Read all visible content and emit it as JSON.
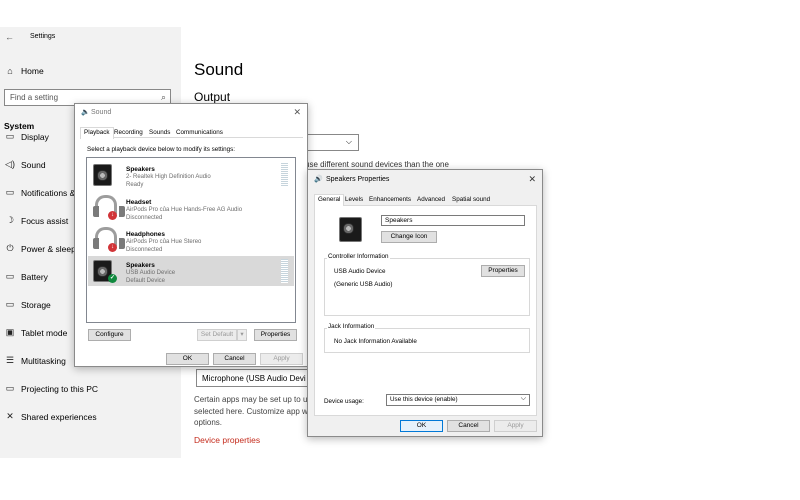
{
  "settings": {
    "title": "Settings",
    "home": "Home",
    "search_placeholder": "Find a setting",
    "section": "System",
    "nav": [
      {
        "label": "Display",
        "icon": "monitor-icon"
      },
      {
        "label": "Sound",
        "icon": "speaker-icon"
      },
      {
        "label": "Notifications &",
        "icon": "notification-icon"
      },
      {
        "label": "Focus assist",
        "icon": "moon-icon"
      },
      {
        "label": "Power & sleep",
        "icon": "power-icon"
      },
      {
        "label": "Battery",
        "icon": "battery-icon"
      },
      {
        "label": "Storage",
        "icon": "storage-icon"
      },
      {
        "label": "Tablet mode",
        "icon": "tablet-icon"
      },
      {
        "label": "Multitasking",
        "icon": "multitasking-icon"
      },
      {
        "label": "Projecting to this PC",
        "icon": "projecting-icon"
      },
      {
        "label": "Shared experiences",
        "icon": "shared-icon"
      }
    ],
    "page_title": "Sound",
    "output_heading": "Output",
    "partial_text": "use different sound devices than the one",
    "input_device": "Microphone (USB Audio Devi",
    "apps_text_1": "Certain apps may be set up to u",
    "apps_text_2": "selected here. Customize app w",
    "apps_text_3": "options.",
    "device_properties_link": "Device properties"
  },
  "sound_dialog": {
    "title": "Sound",
    "tabs": [
      "Playback",
      "Recording",
      "Sounds",
      "Communications"
    ],
    "instruction": "Select a playback device below to modify its settings:",
    "devices": [
      {
        "name": "Speakers",
        "line1": "2- Realtek High Definition Audio",
        "line2": "Ready",
        "icon": "speaker-icon"
      },
      {
        "name": "Headset",
        "line1": "AirPods Pro của Hue Hands-Free AG Audio",
        "line2": "Disconnected",
        "icon": "headset-icon"
      },
      {
        "name": "Headphones",
        "line1": "AirPods Pro của Hue Stereo",
        "line2": "Disconnected",
        "icon": "headphones-icon"
      },
      {
        "name": "Speakers",
        "line1": "USB Audio Device",
        "line2": "Default Device",
        "icon": "speaker-icon"
      }
    ],
    "configure": "Configure",
    "set_default": "Set Default",
    "properties": "Properties",
    "ok": "OK",
    "cancel": "Cancel",
    "apply": "Apply"
  },
  "props_dialog": {
    "title": "Speakers Properties",
    "tabs": [
      "General",
      "Levels",
      "Enhancements",
      "Advanced",
      "Spatial sound"
    ],
    "name_value": "Speakers",
    "change_icon": "Change Icon",
    "controller_heading": "Controller Information",
    "controller_name": "USB Audio Device",
    "controller_sub": "(Generic USB Audio)",
    "controller_properties": "Properties",
    "jack_heading": "Jack Information",
    "jack_text": "No Jack Information Available",
    "usage_label": "Device usage:",
    "usage_value": "Use this device (enable)",
    "ok": "OK",
    "cancel": "Cancel",
    "apply": "Apply"
  },
  "colors": {
    "accent": "#0078d7",
    "link": "#c42b1c",
    "selected_row": "#d9d9d9"
  }
}
